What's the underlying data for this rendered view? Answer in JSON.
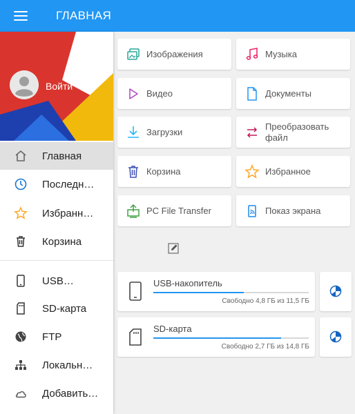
{
  "header": {
    "menu_icon": "hamburger-menu-icon",
    "title": "ГЛАВНАЯ",
    "bar_color": "#2196f3"
  },
  "drawer": {
    "profile": {
      "login_label": "Войти",
      "avatar_icon": "account-circle-icon"
    },
    "items": [
      {
        "label": "Главная",
        "icon": "home-icon",
        "active": true
      },
      {
        "label": "Последн…",
        "icon": "clock-icon"
      },
      {
        "label": "Избранн…",
        "icon": "star-icon"
      },
      {
        "label": "Корзина",
        "icon": "trash-icon"
      },
      {
        "label": "USB…",
        "icon": "phone-icon"
      },
      {
        "label": "SD-карта",
        "icon": "sd-card-icon"
      },
      {
        "label": "FTP",
        "icon": "globe-icon"
      },
      {
        "label": "Локальн…",
        "icon": "network-icon"
      },
      {
        "label": "Добавить…",
        "icon": "cloud-icon"
      }
    ]
  },
  "categories": [
    {
      "label": "Изображения",
      "icon": "images-icon",
      "color": "#26a69a"
    },
    {
      "label": "Музыка",
      "icon": "music-icon",
      "color": "#e91e63"
    },
    {
      "label": "Видео",
      "icon": "play-icon",
      "color": "#ab47bc"
    },
    {
      "label": "Документы",
      "icon": "document-icon",
      "color": "#2196f3"
    },
    {
      "label": "Загрузки",
      "icon": "download-icon",
      "color": "#29b6f6"
    },
    {
      "label": "Преобразовать файл",
      "icon": "convert-icon",
      "color": "#c2185b"
    },
    {
      "label": "Корзина",
      "icon": "trash-icon",
      "color": "#3f51b5"
    },
    {
      "label": "Избранное",
      "icon": "star-icon",
      "color": "#ffa726"
    },
    {
      "label": "PC File Transfer",
      "icon": "pc-transfer-icon",
      "color": "#43a047"
    },
    {
      "label": "Показ экрана",
      "icon": "screen-cast-icon",
      "color": "#1e88e5"
    }
  ],
  "storage": [
    {
      "name": "USB-накопитель",
      "free_text": "Свободно 4,8 ГБ из 11,5 ГБ",
      "used_fraction": 0.58,
      "icon": "phone-icon"
    },
    {
      "name": "SD-карта",
      "free_text": "Свободно 2,7 ГБ из 14,8 ГБ",
      "used_fraction": 0.82,
      "icon": "sd-card-icon"
    }
  ],
  "edit_icon": "edit-icon",
  "pie_icon": "pie-chart-icon"
}
